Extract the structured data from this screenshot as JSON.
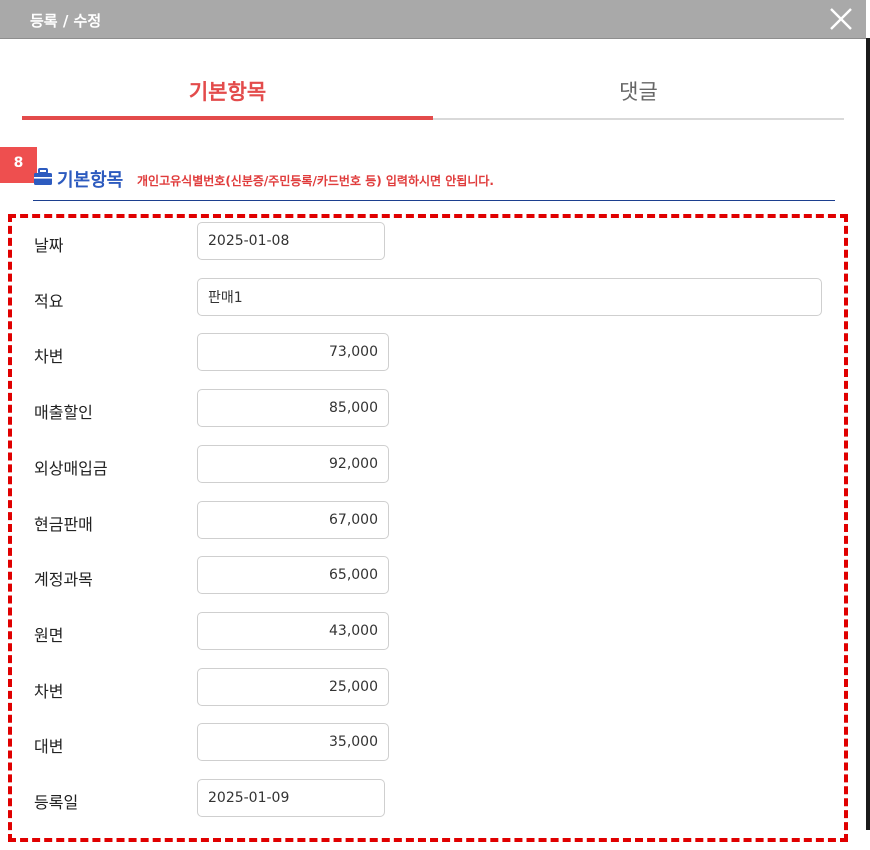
{
  "window": {
    "title": "등록 / 수정",
    "close_icon": "close-icon"
  },
  "tabs": [
    {
      "label": "기본항목",
      "active": true
    },
    {
      "label": "댓글",
      "active": false
    }
  ],
  "badge": "8",
  "section": {
    "icon": "briefcase-icon",
    "heading": "기본항목",
    "notice": "개인고유식별번호(신분증/주민등록/카드번호 등) 입력하시면 안됩니다."
  },
  "form": {
    "fields": [
      {
        "label": "날짜",
        "value": "2025-01-08",
        "kind": "date"
      },
      {
        "label": "적요",
        "value": "판매1",
        "kind": "wide"
      },
      {
        "label": "차변",
        "value": "73,000",
        "kind": "num"
      },
      {
        "label": "매출할인",
        "value": "85,000",
        "kind": "num"
      },
      {
        "label": "외상매입금",
        "value": "92,000",
        "kind": "num"
      },
      {
        "label": "현금판매",
        "value": "67,000",
        "kind": "num"
      },
      {
        "label": "계정과목",
        "value": "65,000",
        "kind": "num"
      },
      {
        "label": "원면",
        "value": "43,000",
        "kind": "num"
      },
      {
        "label": "차변",
        "value": "25,000",
        "kind": "num"
      },
      {
        "label": "대변",
        "value": "35,000",
        "kind": "num"
      },
      {
        "label": "등록일",
        "value": "2025-01-09",
        "kind": "date"
      }
    ]
  },
  "colors": {
    "accent": "#e34b4b",
    "section_blue": "#2d5bbf",
    "frame": "#e00000",
    "titlebar": "#a9a9a9"
  }
}
